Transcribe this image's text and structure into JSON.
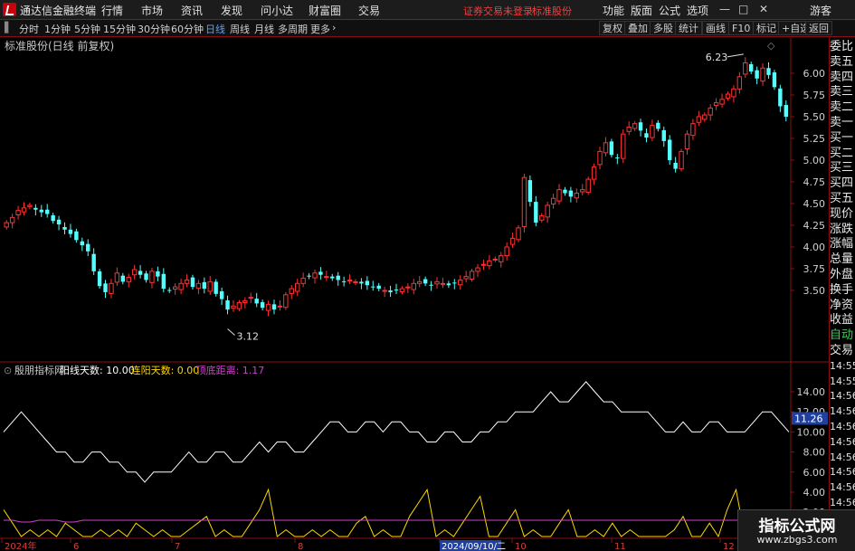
{
  "app": {
    "title": "通达信金融终端",
    "menu": [
      "行情",
      "市场",
      "资讯",
      "发现",
      "问小达",
      "财富圈",
      "交易"
    ],
    "warning": "证券交易未登录",
    "stock_tag": "标准股份",
    "right_menu": [
      "功能",
      "版面",
      "公式",
      "选项"
    ],
    "guest": "游客",
    "window_buttons": {
      "minimize": "—",
      "maximize": "□",
      "close": "✕"
    }
  },
  "toolbar": {
    "periods": [
      "分时",
      "1分钟",
      "5分钟",
      "15分钟",
      "30分钟",
      "60分钟",
      "日线",
      "周线",
      "月线",
      "多周期",
      "更多"
    ],
    "active_period": "日线",
    "more_arrow": "›",
    "right_buttons": [
      "复权",
      "叠加",
      "多股",
      "统计",
      "画线",
      "F10",
      "标记",
      "+自选",
      "返回"
    ]
  },
  "main_panel": {
    "title": "标准股份(日线 前复权)",
    "high_label": "6.23",
    "low_label": "3.12",
    "diamond": "◇"
  },
  "indicator_panel": {
    "name": "殷朋指标网",
    "items": [
      {
        "label": "阳线天数: 10.00",
        "color": "#ffffff"
      },
      {
        "label": "连阳天数: 0.00",
        "color": "#ffd700"
      },
      {
        "label": "顶底距离: 1.17",
        "color": "#d040d0"
      }
    ],
    "current_value": "11.26"
  },
  "side_panel": {
    "items": [
      "委比",
      "卖五",
      "卖四",
      "卖三",
      "卖二",
      "卖一",
      "买一",
      "买二",
      "买三",
      "买四",
      "买五",
      "现价",
      "涨跌",
      "涨幅",
      "总量",
      "外盘",
      "换手",
      "净资",
      "收益",
      "自动",
      "交易",
      "14:55",
      "14:55",
      "14:56",
      "14:56",
      "14:56",
      "14:56",
      "14:56",
      "14:56",
      "14:56",
      "14:56"
    ]
  },
  "chart_data": {
    "type": "candlestick",
    "price_axis_ticks": [
      "6.00",
      "5.75",
      "5.50",
      "5.25",
      "5.00",
      "4.75",
      "4.50",
      "4.25",
      "4.00",
      "3.75",
      "3.50"
    ],
    "indicator_axis_ticks": [
      "14.00",
      "12.00",
      "10.00",
      "8.00",
      "6.00",
      "4.00",
      "2.00"
    ],
    "date_axis": [
      "2024年",
      "6",
      "7",
      "8",
      "2024/09/10/二",
      "10",
      "11",
      "12"
    ],
    "highest": 6.23,
    "lowest": 3.12,
    "closes": [
      4.28,
      4.34,
      4.42,
      4.45,
      4.48,
      4.43,
      4.4,
      4.38,
      4.3,
      4.26,
      4.2,
      4.15,
      4.08,
      4.02,
      3.95,
      3.72,
      3.55,
      3.48,
      3.58,
      3.7,
      3.6,
      3.65,
      3.74,
      3.68,
      3.62,
      3.72,
      3.66,
      3.52,
      3.5,
      3.54,
      3.58,
      3.62,
      3.54,
      3.58,
      3.52,
      3.6,
      3.46,
      3.4,
      3.28,
      3.32,
      3.36,
      3.38,
      3.42,
      3.35,
      3.3,
      3.34,
      3.28,
      3.32,
      3.45,
      3.52,
      3.58,
      3.64,
      3.66,
      3.7,
      3.68,
      3.66,
      3.64,
      3.62,
      3.6,
      3.62,
      3.6,
      3.58,
      3.56,
      3.54,
      3.52,
      3.5,
      3.48,
      3.5,
      3.52,
      3.54,
      3.58,
      3.6,
      3.58,
      3.56,
      3.6,
      3.58,
      3.56,
      3.58,
      3.62,
      3.66,
      3.72,
      3.76,
      3.8,
      3.84,
      3.86,
      3.9,
      4.0,
      4.1,
      4.22,
      4.8,
      4.52,
      4.28,
      4.36,
      4.48,
      4.56,
      4.66,
      4.62,
      4.58,
      4.62,
      4.66,
      4.78,
      4.92,
      5.1,
      5.2,
      5.06,
      5.02,
      5.3,
      5.38,
      5.42,
      5.34,
      5.26,
      5.4,
      5.36,
      5.22,
      5.0,
      4.9,
      5.1,
      5.3,
      5.42,
      5.5,
      5.52,
      5.6,
      5.66,
      5.7,
      5.76,
      5.82,
      5.96,
      6.12,
      6.02,
      5.94,
      6.06,
      5.98,
      5.84,
      5.62,
      5.5
    ],
    "indicator_lines": [
      {
        "name": "阳线天数",
        "color": "#ffffff",
        "values": [
          10,
          11,
          12,
          11,
          10,
          9,
          8,
          8,
          7,
          7,
          8,
          8,
          7,
          7,
          6,
          6,
          5,
          6,
          6,
          6,
          7,
          8,
          7,
          7,
          8,
          8,
          7,
          7,
          8,
          9,
          8,
          9,
          9,
          8,
          8,
          9,
          10,
          11,
          11,
          10,
          10,
          11,
          11,
          10,
          11,
          11,
          10,
          10,
          9,
          9,
          10,
          10,
          9,
          9,
          10,
          10,
          11,
          11,
          12,
          12,
          12,
          13,
          14,
          13,
          13,
          14,
          15,
          14,
          13,
          13,
          12,
          12,
          12,
          12,
          11,
          10,
          10,
          11,
          10,
          10,
          11,
          11,
          10,
          10,
          10,
          11,
          12,
          12,
          11,
          10
        ]
      },
      {
        "name": "连阳天数",
        "color": "#ffd700",
        "values": [
          4,
          2,
          0,
          1,
          0,
          1,
          0,
          2,
          1,
          0,
          0,
          1,
          0,
          1,
          0,
          2,
          1,
          0,
          1,
          0,
          0,
          1,
          2,
          3,
          0,
          1,
          0,
          0,
          2,
          4,
          7,
          0,
          1,
          0,
          0,
          1,
          0,
          1,
          0,
          0,
          2,
          3,
          0,
          1,
          0,
          0,
          3,
          5,
          7,
          0,
          1,
          0,
          2,
          4,
          6,
          0,
          0,
          2,
          4,
          0,
          1,
          0,
          0,
          2,
          4,
          0,
          0,
          1,
          0,
          2,
          0,
          1,
          0,
          0,
          0,
          0,
          1,
          3,
          0,
          0,
          2,
          0,
          4,
          7,
          0,
          0,
          3,
          0,
          1,
          0
        ]
      },
      {
        "name": "顶底距离",
        "color": "#d040d0",
        "values": [
          1.2,
          1.2,
          1.1,
          1.1,
          1.2,
          1.2,
          1.2,
          1.1,
          1.1,
          1.2,
          1.2,
          1.2,
          1.2,
          1.2,
          1.2,
          1.2,
          1.2,
          1.2,
          1.2,
          1.2,
          1.2,
          1.2,
          1.2,
          1.2,
          1.2,
          1.2,
          1.2,
          1.2,
          1.2,
          1.2,
          1.2,
          1.2,
          1.2,
          1.2,
          1.2,
          1.2,
          1.2,
          1.2,
          1.2,
          1.2,
          1.2,
          1.2,
          1.2,
          1.2,
          1.2,
          1.2,
          1.2,
          1.2,
          1.2,
          1.2,
          1.2,
          1.2,
          1.2,
          1.2,
          1.2,
          1.2,
          1.2,
          1.2,
          1.2,
          1.2,
          1.2,
          1.2,
          1.2,
          1.2,
          1.2,
          1.2,
          1.2,
          1.2,
          1.2,
          1.2,
          1.2,
          1.2,
          1.2,
          1.2,
          1.2,
          1.2,
          1.2,
          1.2,
          1.2,
          1.2,
          1.2,
          1.2,
          1.2,
          1.2,
          1.2,
          1.2,
          1.2,
          1.2,
          1.2,
          1.17
        ]
      }
    ]
  },
  "watermark": {
    "main": "指标公式网",
    "sub": "www.zbgs3.com"
  }
}
